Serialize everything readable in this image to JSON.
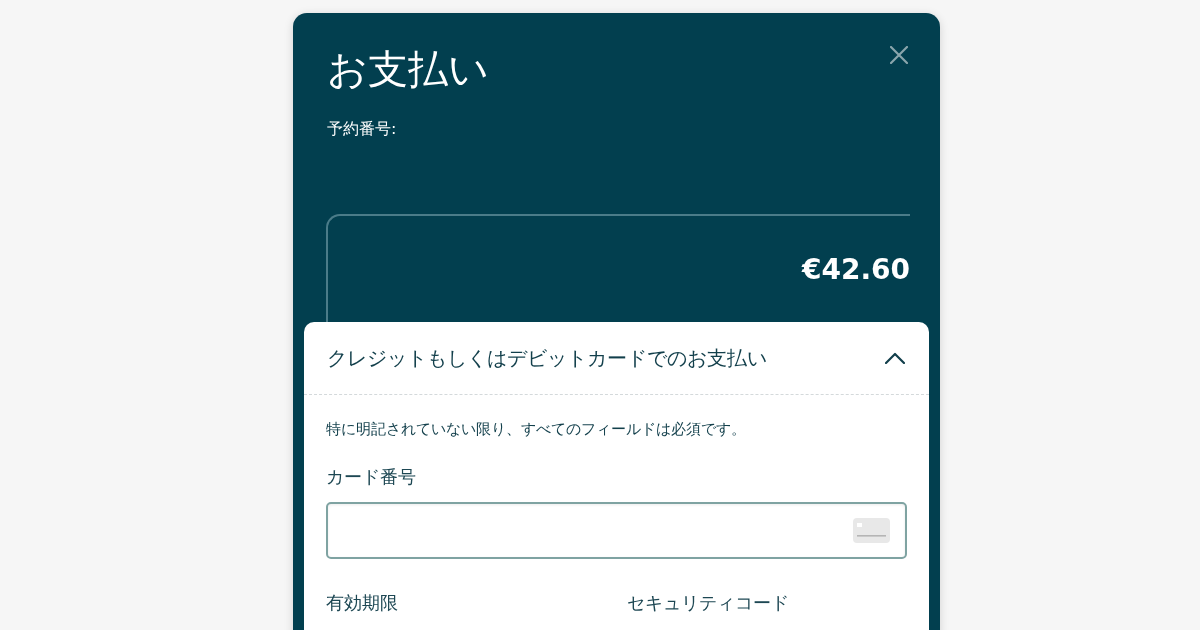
{
  "dialog": {
    "title": "お支払い",
    "booking_number_label": "予約番号:",
    "amount": "€42.60"
  },
  "payment_panel": {
    "title": "クレジットもしくはデビットカードでのお支払い",
    "expanded": true,
    "note": "特に明記されていない限り、すべてのフィールドは必須です。",
    "fields": [
      {
        "kind": "card-number",
        "label": "カード番号"
      },
      {
        "kind": "half",
        "label": "有効期限"
      },
      {
        "kind": "half",
        "label": "セキュリティコード"
      }
    ]
  }
}
